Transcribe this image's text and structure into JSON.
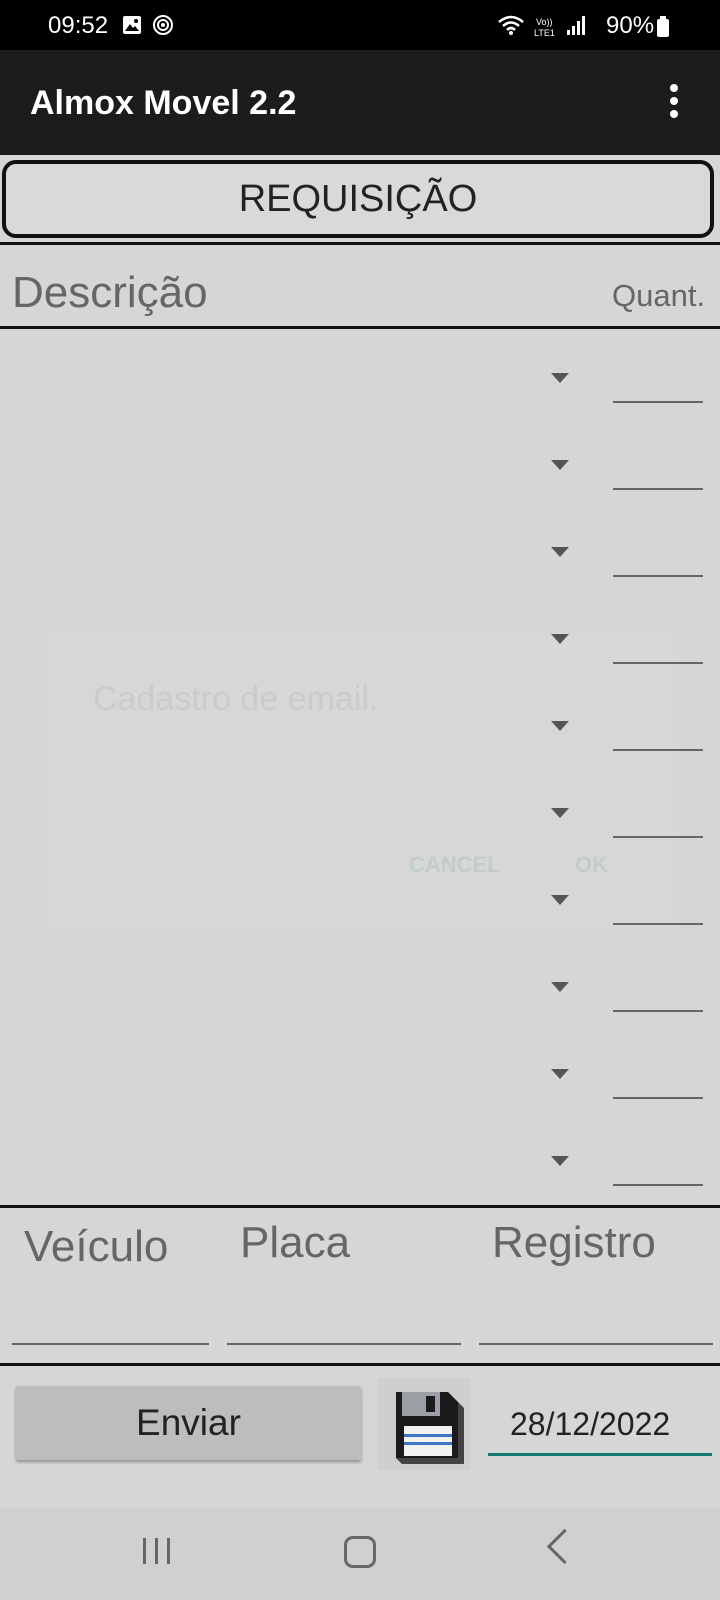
{
  "status_bar": {
    "time": "09:52",
    "battery": "90%",
    "icons": [
      "image-icon",
      "target-icon",
      "wifi-icon",
      "volte-icon",
      "signal-icon",
      "battery-icon"
    ]
  },
  "app_bar": {
    "title": "Almox Movel 2.2",
    "menu_icon": "more-vert-icon"
  },
  "requisicao": {
    "label": "REQUISIÇÃO"
  },
  "table": {
    "desc_header": "Descrição",
    "quant_header": "Quant.",
    "rows": [
      {
        "item": "",
        "qty": ""
      },
      {
        "item": "",
        "qty": ""
      },
      {
        "item": "",
        "qty": ""
      },
      {
        "item": "",
        "qty": ""
      },
      {
        "item": "",
        "qty": ""
      },
      {
        "item": "",
        "qty": ""
      },
      {
        "item": "",
        "qty": ""
      },
      {
        "item": "",
        "qty": ""
      },
      {
        "item": "",
        "qty": ""
      },
      {
        "item": "",
        "qty": ""
      }
    ]
  },
  "ghost_dialog": {
    "title": "Cadastro de email.",
    "cancel": "CANCEL",
    "ok": "OK"
  },
  "form": {
    "vehicle_label": "Veículo",
    "plate_label": "Placa",
    "registry_label": "Registro",
    "vehicle_value": "",
    "plate_value": "",
    "registry_value": ""
  },
  "actions": {
    "send_label": "Enviar",
    "save_icon": "floppy-disk-icon",
    "date": "28/12/2022"
  },
  "colors": {
    "accent": "#0f7a72",
    "appbar": "#1c1c1c",
    "background": "#d6d6d6"
  }
}
